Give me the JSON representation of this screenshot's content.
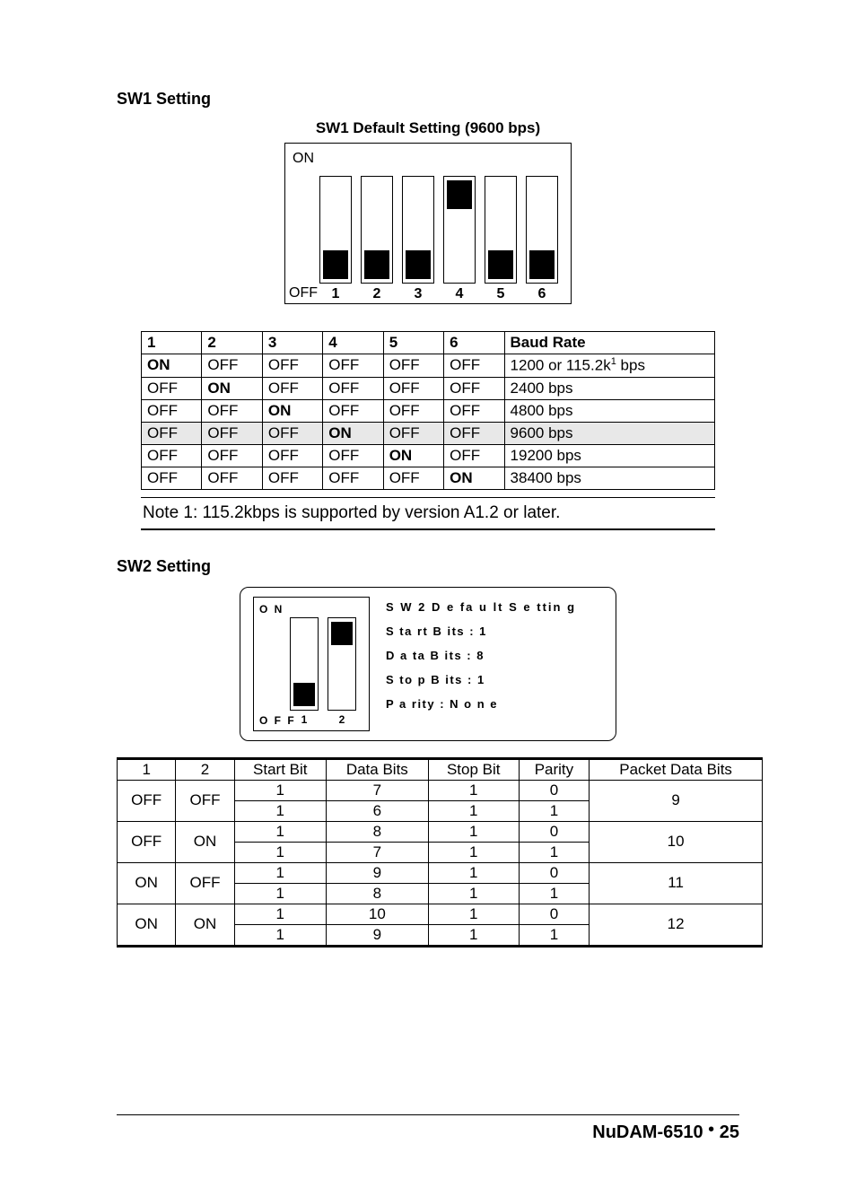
{
  "sw1": {
    "heading": "SW1 Setting",
    "default_label": "SW1 Default Setting (9600 bps)",
    "on_label": "ON",
    "off_label": "OFF",
    "slot_numbers": [
      "1",
      "2",
      "3",
      "4",
      "5",
      "6"
    ],
    "slot_states": [
      "off",
      "off",
      "off",
      "on",
      "off",
      "off"
    ],
    "table": {
      "headers": [
        "1",
        "2",
        "3",
        "4",
        "5",
        "6",
        "Baud Rate"
      ],
      "rows": [
        {
          "cells": [
            "ON",
            "OFF",
            "OFF",
            "OFF",
            "OFF",
            "OFF"
          ],
          "bold_idx": 0,
          "baud_prefix": "1200 or 115.2k",
          "baud_sup": "1",
          "baud_suffix": " bps",
          "hl": false
        },
        {
          "cells": [
            "OFF",
            "ON",
            "OFF",
            "OFF",
            "OFF",
            "OFF"
          ],
          "bold_idx": 1,
          "baud": "2400 bps",
          "hl": false
        },
        {
          "cells": [
            "OFF",
            "OFF",
            "ON",
            "OFF",
            "OFF",
            "OFF"
          ],
          "bold_idx": 2,
          "baud": "4800 bps",
          "hl": false
        },
        {
          "cells": [
            "OFF",
            "OFF",
            "OFF",
            "ON",
            "OFF",
            "OFF"
          ],
          "bold_idx": 3,
          "baud": "9600 bps",
          "hl": true
        },
        {
          "cells": [
            "OFF",
            "OFF",
            "OFF",
            "OFF",
            "ON",
            "OFF"
          ],
          "bold_idx": 4,
          "baud": "19200  bps",
          "hl": false
        },
        {
          "cells": [
            "OFF",
            "OFF",
            "OFF",
            "OFF",
            "OFF",
            "ON"
          ],
          "bold_idx": 5,
          "baud": "38400  bps",
          "hl": false
        }
      ]
    },
    "note": "Note 1: 115.2kbps is supported by version A1.2 or later."
  },
  "sw2": {
    "heading": "SW2 Setting",
    "panel": {
      "on_label": "O N",
      "off_label": "O F F",
      "slot_numbers": [
        "1",
        "2"
      ],
      "slot_states": [
        "off",
        "on"
      ],
      "title": "S W 2  D e fa u lt  S e ttin g",
      "lines": [
        "S ta rt  B its  :  1",
        "D a ta  B its  :  8",
        "S to p  B its  :  1",
        "P a rity  :  N o n e"
      ]
    },
    "table": {
      "headers": [
        "1",
        "2",
        "Start Bit",
        "Data Bits",
        "Stop Bit",
        "Parity",
        "Packet Data Bits"
      ],
      "groups": [
        {
          "c1": "OFF",
          "c2": "OFF",
          "rows": [
            [
              "1",
              "7",
              "1",
              "0",
              "9"
            ],
            [
              "1",
              "6",
              "1",
              "1",
              ""
            ]
          ]
        },
        {
          "c1": "OFF",
          "c2": "ON",
          "rows": [
            [
              "1",
              "8",
              "1",
              "0",
              "10"
            ],
            [
              "1",
              "7",
              "1",
              "1",
              ""
            ]
          ]
        },
        {
          "c1": "ON",
          "c2": "OFF",
          "rows": [
            [
              "1",
              "9",
              "1",
              "0",
              "11"
            ],
            [
              "1",
              "8",
              "1",
              "1",
              ""
            ]
          ]
        },
        {
          "c1": "ON",
          "c2": "ON",
          "rows": [
            [
              "1",
              "10",
              "1",
              "0",
              "12"
            ],
            [
              "1",
              "9",
              "1",
              "1",
              ""
            ]
          ]
        }
      ]
    }
  },
  "footer": {
    "product": "NuDAM-6510",
    "dot": "•",
    "page": "25"
  }
}
